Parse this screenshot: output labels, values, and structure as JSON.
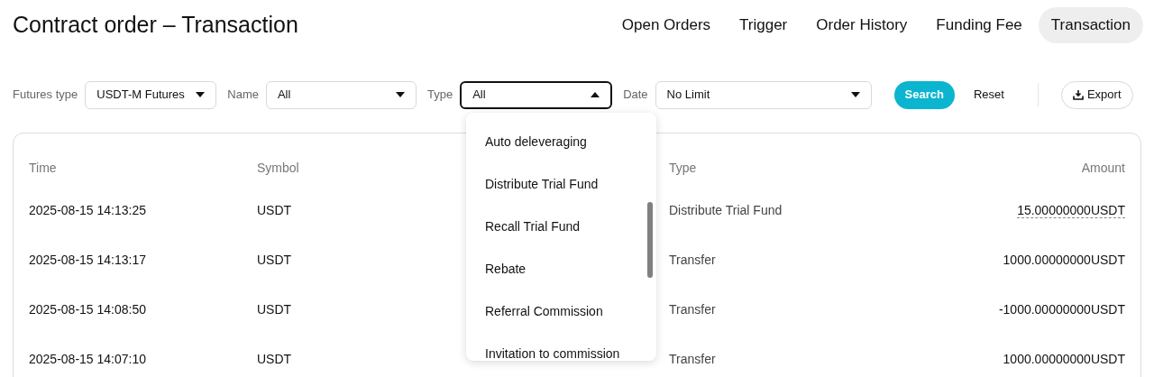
{
  "title": "Contract order – Transaction",
  "tabs": [
    {
      "label": "Open Orders",
      "selected": false
    },
    {
      "label": "Trigger",
      "selected": false
    },
    {
      "label": "Order History",
      "selected": false
    },
    {
      "label": "Funding Fee",
      "selected": false
    },
    {
      "label": "Transaction",
      "selected": true
    }
  ],
  "filters": [
    {
      "label": "Futures type",
      "value": "USDT-M Futures",
      "open": false
    },
    {
      "label": "Name",
      "value": "All",
      "open": false
    },
    {
      "label": "Type",
      "value": "All",
      "open": true
    },
    {
      "label": "Date",
      "value": "No Limit",
      "open": false
    }
  ],
  "buttons": {
    "search": "Search",
    "reset": "Reset",
    "export": "Export"
  },
  "dropdown_options": [
    "Auto deleveraging",
    "Distribute Trial Fund",
    "Recall Trial Fund",
    "Rebate",
    "Referral Commission",
    "Invitation to commission"
  ],
  "table": {
    "columns": [
      "Time",
      "Symbol",
      "Type",
      "Amount"
    ],
    "rows": [
      {
        "time": "2025-08-15 14:13:25",
        "symbol": "USDT",
        "type": "Distribute Trial Fund",
        "amount": "15.00000000USDT",
        "has_tooltip": true
      },
      {
        "time": "2025-08-15 14:13:17",
        "symbol": "USDT",
        "type": "Transfer",
        "amount": "1000.00000000USDT",
        "has_tooltip": false
      },
      {
        "time": "2025-08-15 14:08:50",
        "symbol": "USDT",
        "type": "Transfer",
        "amount": "-1000.00000000USDT",
        "has_tooltip": false
      },
      {
        "time": "2025-08-15 14:07:10",
        "symbol": "USDT",
        "type": "Transfer",
        "amount": "1000.00000000USDT",
        "has_tooltip": false
      }
    ]
  }
}
